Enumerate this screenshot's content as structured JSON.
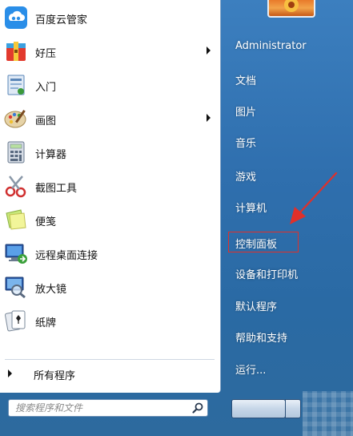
{
  "programs": [
    {
      "label": "百度云管家",
      "icon": "cloud-icon",
      "has_submenu": false
    },
    {
      "label": "好压",
      "icon": "archive-icon",
      "has_submenu": true
    },
    {
      "label": "入门",
      "icon": "getting-started-icon",
      "has_submenu": false
    },
    {
      "label": "画图",
      "icon": "paint-palette-icon",
      "has_submenu": true
    },
    {
      "label": "计算器",
      "icon": "calculator-icon",
      "has_submenu": false
    },
    {
      "label": "截图工具",
      "icon": "scissors-icon",
      "has_submenu": false
    },
    {
      "label": "便笺",
      "icon": "sticky-note-icon",
      "has_submenu": false
    },
    {
      "label": "远程桌面连接",
      "icon": "remote-desktop-icon",
      "has_submenu": false
    },
    {
      "label": "放大镜",
      "icon": "magnifier-icon",
      "has_submenu": false
    },
    {
      "label": "纸牌",
      "icon": "cards-icon",
      "has_submenu": false
    }
  ],
  "all_programs_label": "所有程序",
  "search": {
    "placeholder": "搜索程序和文件"
  },
  "right_items": [
    {
      "label": "Administrator"
    },
    {
      "label": "文档"
    },
    {
      "label": "图片"
    },
    {
      "label": "音乐"
    },
    {
      "label": "游戏"
    },
    {
      "label": "计算机"
    },
    {
      "label": "控制面板",
      "highlighted": true
    },
    {
      "label": "设备和打印机"
    },
    {
      "label": "默认程序"
    },
    {
      "label": "帮助和支持"
    },
    {
      "label": "运行..."
    }
  ],
  "colors": {
    "highlight_box": "#e0302a",
    "annotation_arrow": "#e0302a",
    "right_pane_bg": "#2f6fae"
  }
}
